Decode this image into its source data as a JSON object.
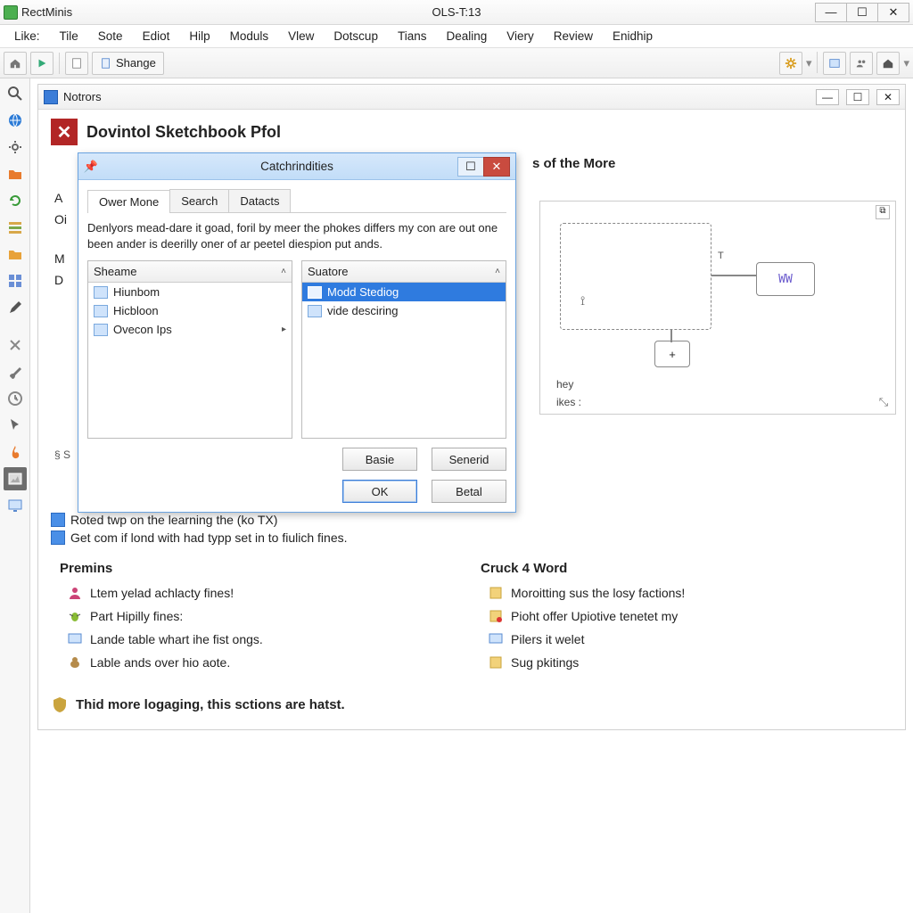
{
  "titlebar": {
    "app_name": "RectMinis",
    "center_title": "OLS-T:13"
  },
  "menu": [
    "Like:",
    "Tile",
    "Sote",
    "Ediot",
    "Hilp",
    "Moduls",
    "Vlew",
    "Dotscup",
    "Tians",
    "Dealing",
    "Viery",
    "Review",
    "Enidhip"
  ],
  "toolbar": {
    "shange_label": "Shange"
  },
  "docwin": {
    "title": "Notrors"
  },
  "banner": {
    "title": "Dovintol Sketchbook Pfol"
  },
  "section_right_title": "s of the More",
  "left_letters": [
    "A",
    "Oi",
    "",
    "M",
    "D"
  ],
  "diagram": {
    "wave_label": "WW",
    "plus_label": "+",
    "cap1": "hey",
    "cap2": "ikes :"
  },
  "infolines": [
    "Roted twp on the learning the (ko TX)",
    "Get com if lond with had typp set in to fiulich fines."
  ],
  "columns": {
    "left": {
      "title": "Premins",
      "items": [
        "Ltem yelad achlacty fines!",
        "Part Hipilly fines:",
        "Lande table whart ihe fist ongs.",
        "Lable ands over hio aote."
      ]
    },
    "right": {
      "title": "Cruck 4 Word",
      "items": [
        "Moroitting sus the losy factions!",
        "Pioht offer Upiotive tenetet my",
        "Pilers it welet",
        "Sug pkitings"
      ]
    }
  },
  "footer": "Thid more logaging, this sctions are hatst.",
  "modal": {
    "title": "Catchrindities",
    "tabs": [
      "Ower Mone",
      "Search",
      "Datacts"
    ],
    "desc": "Denlyors mead-dare it goad, foril by meer the phokes differs my con are out one been ander is deerilly oner of ar peetel diespion put ands.",
    "left_header": "Sheame",
    "right_header": "Suatore",
    "left_items": [
      "Hiunbom",
      "Hicbloon",
      "Ovecon Ips"
    ],
    "right_items": [
      "Modd Stediog",
      "vide desciring"
    ],
    "btn_basie": "Basie",
    "btn_senerid": "Senerid",
    "btn_ok": "OK",
    "btn_betal": "Betal"
  },
  "lefthint": "§ S"
}
